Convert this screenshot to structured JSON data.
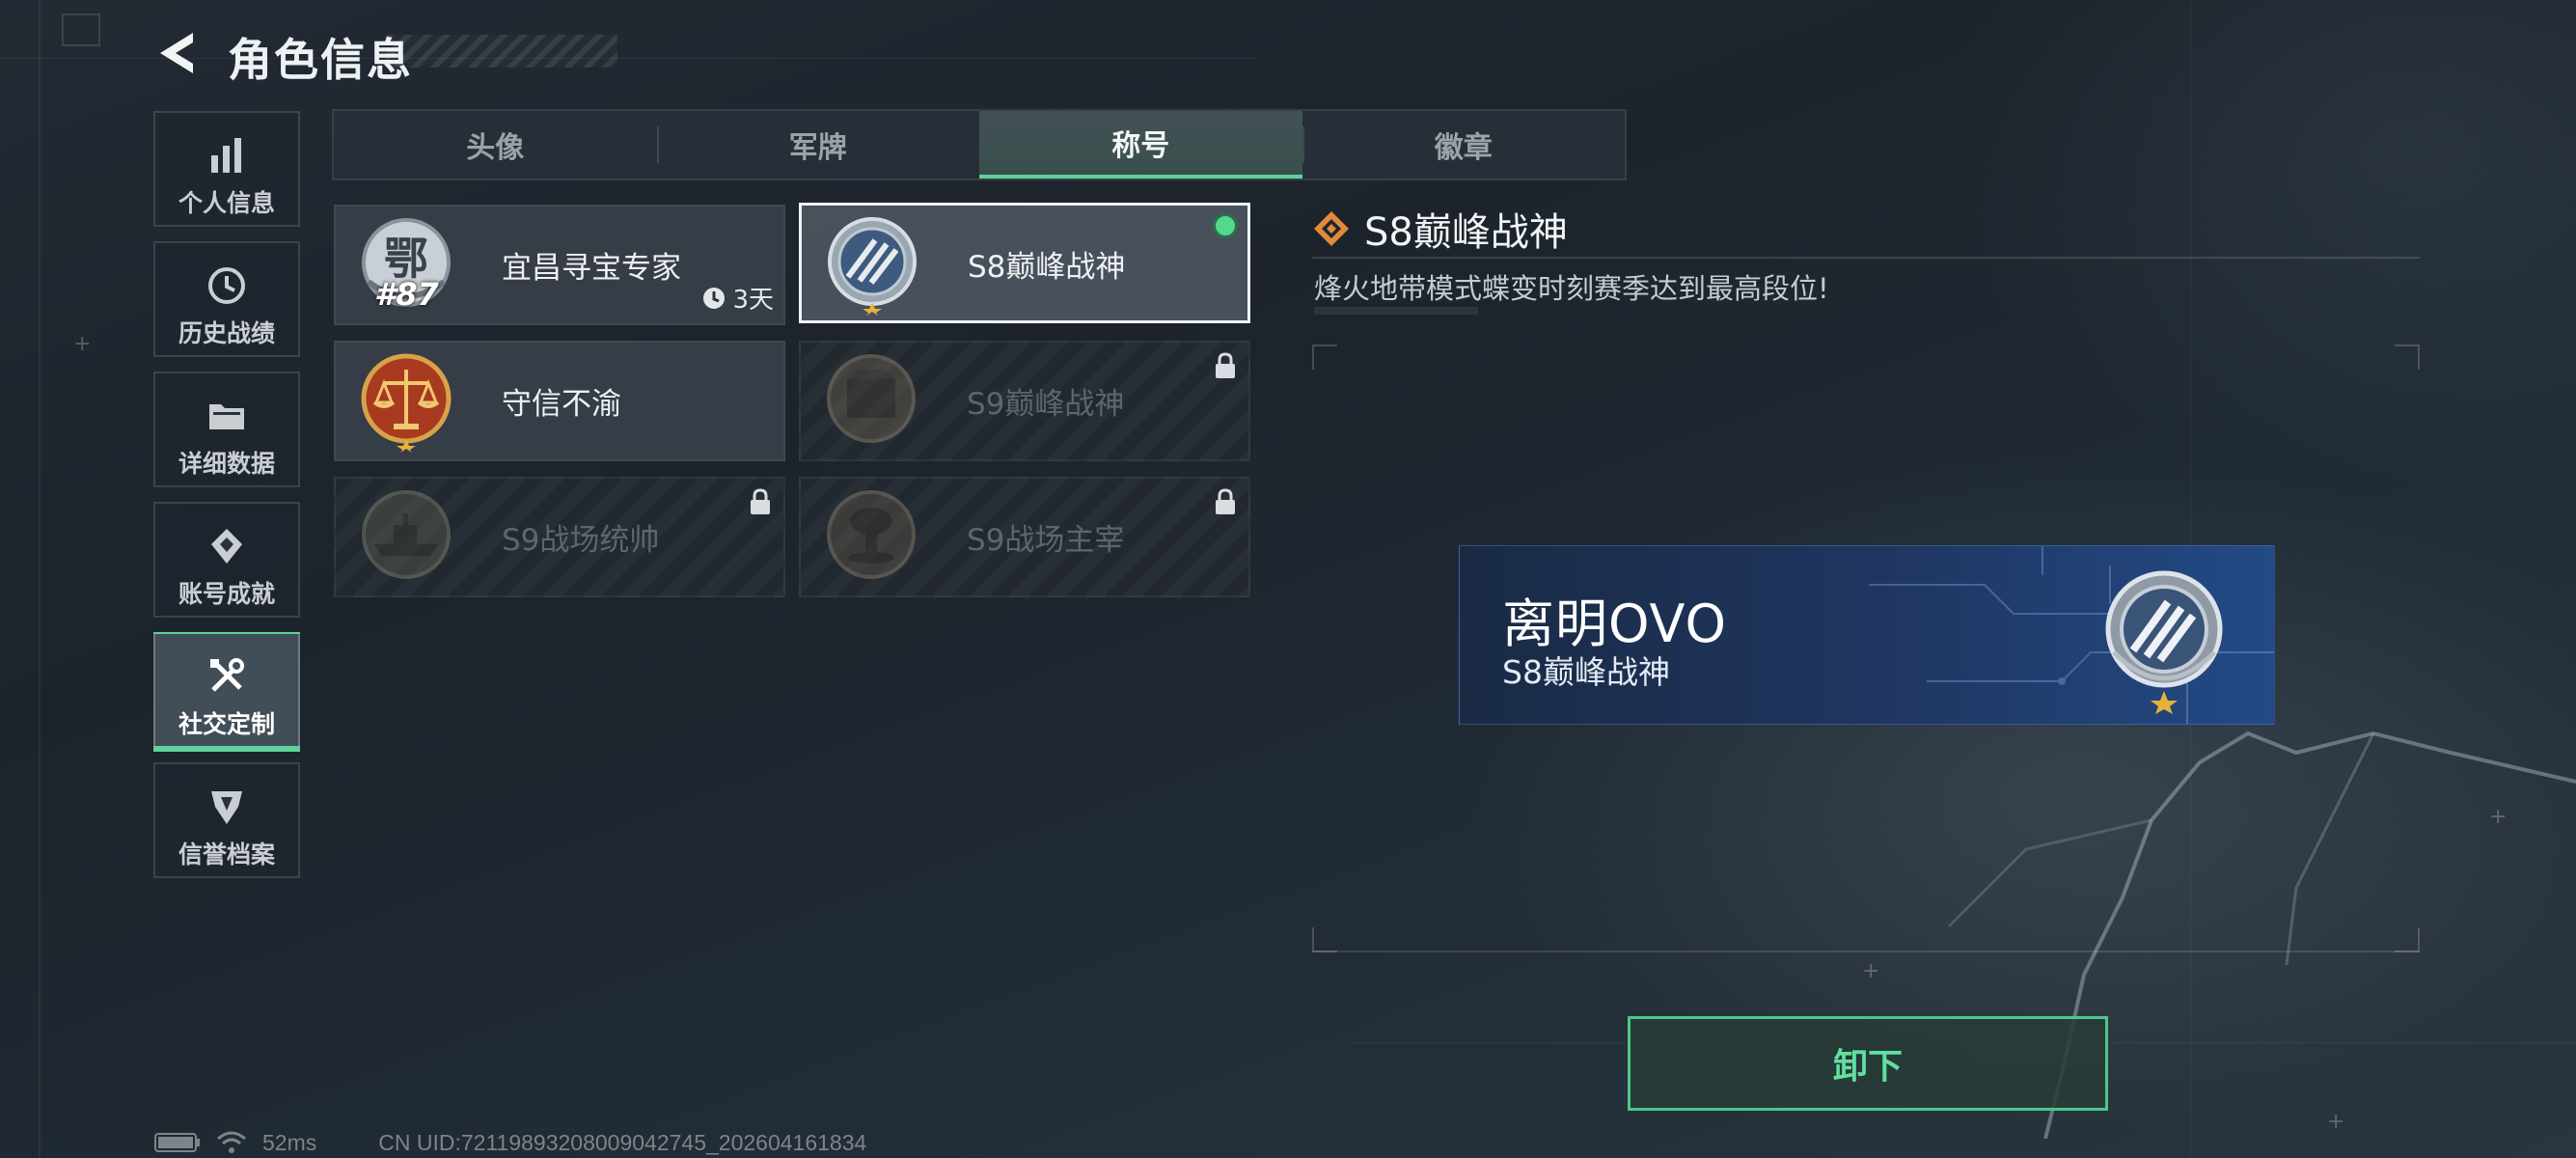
{
  "header": {
    "title": "角色信息"
  },
  "side_nav": {
    "items": [
      {
        "label": "个人信息",
        "icon": "bar-chart-icon",
        "active": false
      },
      {
        "label": "历史战绩",
        "icon": "history-clock-icon",
        "active": false
      },
      {
        "label": "详细数据",
        "icon": "folder-icon",
        "active": false
      },
      {
        "label": "账号成就",
        "icon": "achievement-icon",
        "active": false
      },
      {
        "label": "社交定制",
        "icon": "tools-icon",
        "active": true
      },
      {
        "label": "信誉档案",
        "icon": "credit-shield-icon",
        "active": false
      }
    ]
  },
  "tabs": [
    {
      "label": "头像",
      "active": false
    },
    {
      "label": "军牌",
      "active": false
    },
    {
      "label": "称号",
      "active": true
    },
    {
      "label": "徽章",
      "active": false
    }
  ],
  "titles": [
    {
      "name": "宜昌寻宝专家",
      "locked": false,
      "selected": false,
      "duration": "3天",
      "badge_number": "#87",
      "emblem_char": "鄂",
      "emblem": "province-emblem-icon"
    },
    {
      "name": "S8巅峰战神",
      "locked": false,
      "selected": true,
      "equipped": true,
      "emblem": "s8-peak-emblem-icon"
    },
    {
      "name": "守信不渝",
      "locked": false,
      "selected": false,
      "emblem": "scales-emblem-icon"
    },
    {
      "name": "S9巅峰战神",
      "locked": true,
      "selected": false,
      "emblem": "fortress-emblem-icon"
    },
    {
      "name": "S9战场统帅",
      "locked": true,
      "selected": false,
      "emblem": "warship-emblem-icon"
    },
    {
      "name": "S9战场主宰",
      "locked": true,
      "selected": false,
      "emblem": "mushroom-cloud-emblem-icon"
    }
  ],
  "detail": {
    "title": "S8巅峰战神",
    "description": "烽火地带模式蝶变时刻赛季达到最高段位!"
  },
  "nameplate": {
    "player_name": "离明OVO",
    "title": "S8巅峰战神"
  },
  "actions": {
    "unequip_label": "卸下"
  },
  "status_bar": {
    "ping": "52ms",
    "uid": "CN UID:72119893208009042745_202604161834"
  },
  "colors": {
    "accent": "#5fd19a",
    "equipped_dot": "#52d98c",
    "nameplate_blue": "#203763"
  }
}
